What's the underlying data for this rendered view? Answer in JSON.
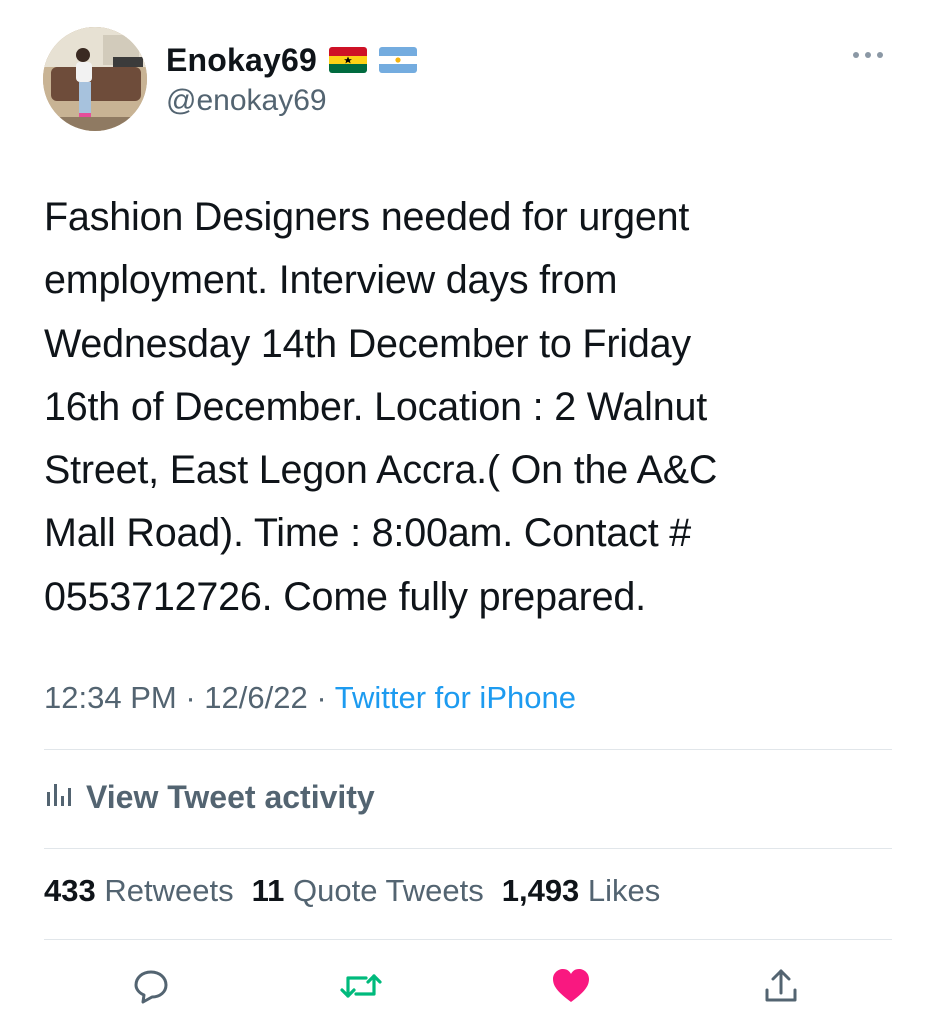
{
  "author": {
    "display_name": "Enokay69",
    "handle": "@enokay69",
    "flags": [
      "ghana-flag-icon",
      "argentina-flag-icon"
    ]
  },
  "tweet": {
    "text": "Fashion Designers needed for urgent\nemployment. Interview days from\nWednesday 14th December to Friday\n16th of December. Location : 2 Walnut\nStreet, East Legon Accra.( On the A&C\nMall Road). Time : 8:00am. Contact #\n0553712726. Come fully prepared.",
    "time": "12:34 PM",
    "separator": "·",
    "date": "12/6/22",
    "source": "Twitter for iPhone"
  },
  "activity": {
    "label": "View Tweet activity"
  },
  "stats": {
    "retweets_count": "433",
    "retweets_label": "Retweets",
    "quotes_count": "11",
    "quotes_label": "Quote Tweets",
    "likes_count": "1,493",
    "likes_label": "Likes"
  },
  "colors": {
    "text": "#0f1419",
    "secondary": "#536471",
    "link": "#1d9bf0",
    "retweet": "#00ba7c",
    "like": "#f91880",
    "divider": "#e1e6ea"
  },
  "icons": [
    "more-icon",
    "activity-chart-icon",
    "reply-icon",
    "retweet-icon",
    "like-icon",
    "share-icon"
  ]
}
